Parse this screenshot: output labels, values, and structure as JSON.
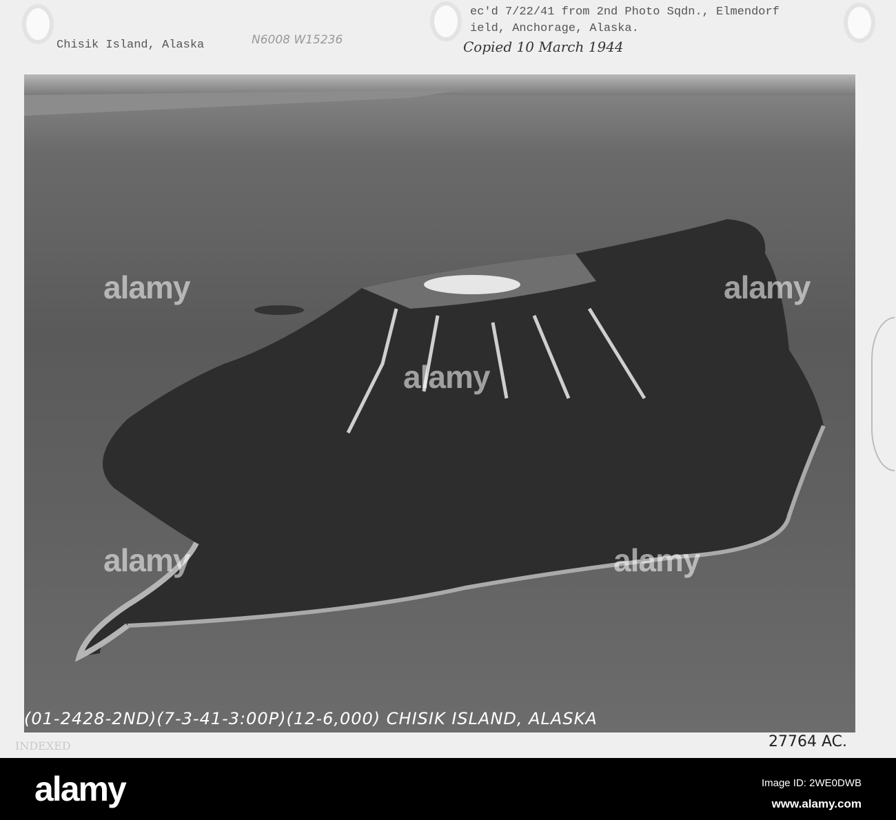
{
  "header": {
    "typed_left": "Chisik Island, Alaska",
    "pencil_coords": "N6008 W15236",
    "typed_right_line1": "ec'd 7/22/41 from 2nd Photo Sqdn., Elmendorf",
    "typed_right_line2": "ield, Anchorage, Alaska.",
    "handwritten": "Copied 10 March 1944"
  },
  "photo": {
    "caption": "(01-2428-2ND)(7-3-41-3:00P)(12-6,000) CHISIK ISLAND, ALASKA",
    "watermark": "alamy"
  },
  "margin": {
    "indexed_stamp": "INDEXED",
    "reference_number": "27764 AC."
  },
  "footer": {
    "logo": "alamy",
    "image_id": "Image ID: 2WE0DWB",
    "website": "www.alamy.com"
  }
}
